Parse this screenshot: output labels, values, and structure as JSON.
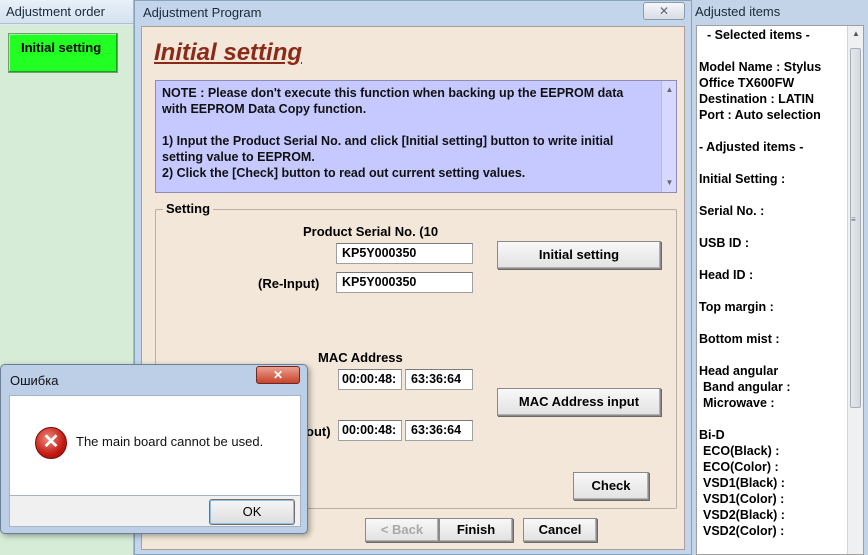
{
  "left_panel": {
    "title": "Adjustment order",
    "items": [
      {
        "label": "Initial setting",
        "color": "#22ff22"
      }
    ]
  },
  "main_window": {
    "title": "Adjustment Program",
    "close_glyph": "✕",
    "page_title": "Initial setting",
    "note": {
      "line1": "NOTE : Please don't execute this function when backing up the EEPROM data",
      "line2": "with EEPROM Data Copy function.",
      "line3": "1) Input the Product Serial No. and click [Initial setting] button to write initial",
      "line4": "setting value to EEPROM.",
      "line5": "2) Click the [Check] button to read out current setting values."
    },
    "setting": {
      "group_label": "Setting",
      "serial_label": "Product Serial No. (10",
      "serial_value": "KP5Y000350",
      "reinput_label": "(Re-Input)",
      "reinput_value": "KP5Y000350",
      "initial_button": "Initial setting",
      "mac_label": "MAC Address",
      "mac_prefix": "00:00:48:",
      "mac_suffix": "63:36:64",
      "mac_reinput_label": "out)",
      "mac_reinput_prefix": "00:00:48:",
      "mac_reinput_suffix": "63:36:64",
      "mac_button": "MAC Address input",
      "check_button": "Check"
    },
    "footer": {
      "back": "< Back",
      "finish": "Finish",
      "cancel": "Cancel"
    }
  },
  "right_panel": {
    "title": "Adjusted items",
    "lines": [
      "- Selected items -",
      "Model Name : Stylus",
      "Office TX600FW",
      "Destination : LATIN",
      "Port : Auto selection",
      "- Adjusted items -",
      "Initial Setting :",
      "Serial No. :",
      "USB ID :",
      "Head ID :",
      "Top margin :",
      "Bottom mist :",
      "Head angular",
      " Band angular :",
      " Microwave :",
      "Bi-D",
      " ECO(Black)  :",
      " ECO(Color)  :",
      " VSD1(Black) :",
      " VSD1(Color) :",
      " VSD2(Black) :",
      " VSD2(Color) :"
    ]
  },
  "error_dialog": {
    "title": "Ошибка",
    "message": "The main board cannot be used.",
    "ok": "OK",
    "icon": "error-icon"
  }
}
